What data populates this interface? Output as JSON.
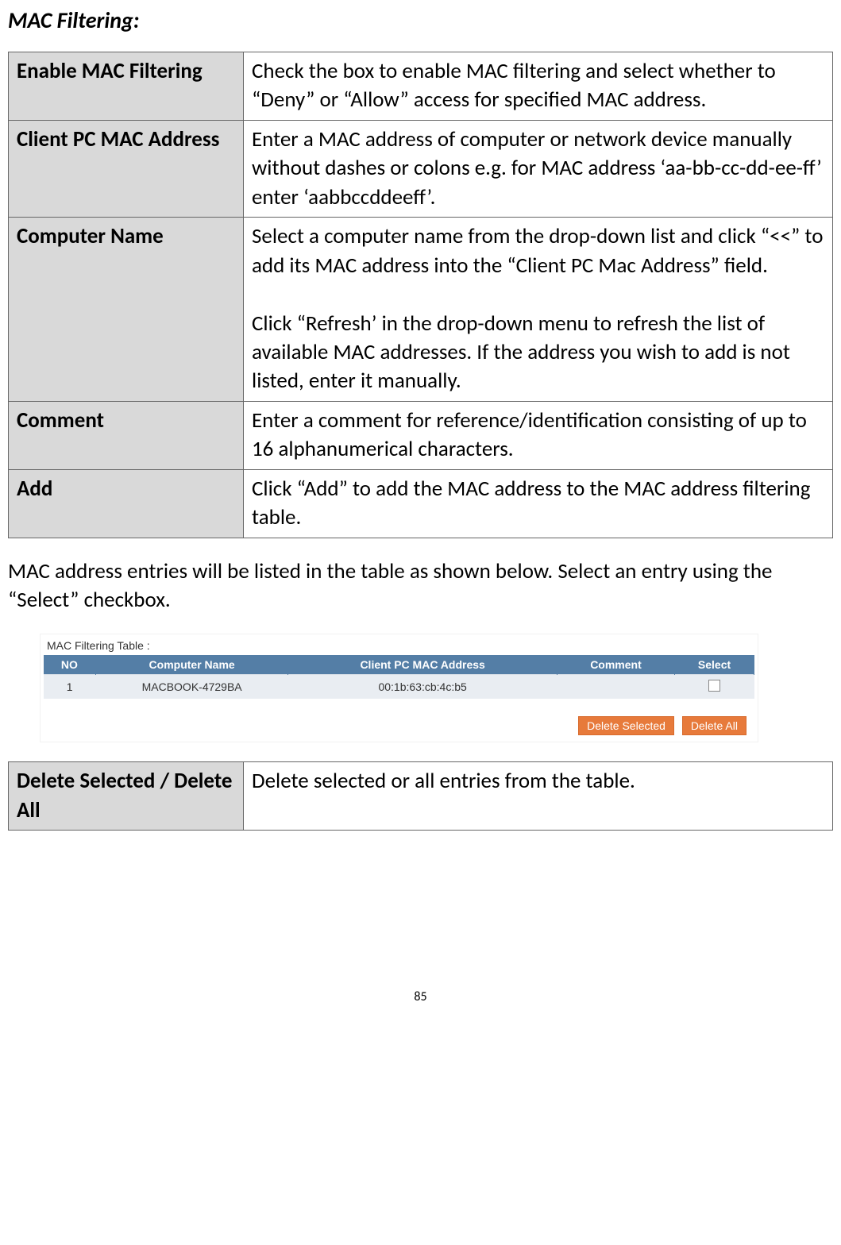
{
  "title": "MAC Filtering:",
  "rows1": [
    {
      "label": "Enable MAC Filtering",
      "desc": "Check the box to enable MAC filtering and select whether to “Deny” or “Allow” access for specified MAC address."
    },
    {
      "label": "Client PC MAC Address",
      "desc": "Enter a MAC address of computer or network device manually without dashes or colons e.g. for MAC address ‘aa-bb-cc-dd-ee-ff’ enter ‘aabbccddeeff’."
    },
    {
      "label": "Computer Name",
      "desc": "Select a computer name from the drop-down list and click “<<” to add its MAC address into the “Client PC Mac Address” field.\n\nClick “Refresh’ in the drop-down menu to refresh the list of available MAC addresses. If the address you wish to add is not listed, enter it manually."
    },
    {
      "label": "Comment",
      "desc": "Enter a comment for reference/identification consisting of up to 16 alphanumerical characters."
    },
    {
      "label": "Add",
      "desc": "Click “Add” to add the MAC address to the MAC address filtering table."
    }
  ],
  "midpara": "MAC address entries will be listed in the table as shown below. Select an entry using the “Select” checkbox.",
  "screenshot": {
    "caption": "MAC Filtering  Table :",
    "headers": {
      "no": "NO",
      "name": "Computer Name",
      "mac": "Client PC   MAC Address",
      "comment": "Comment",
      "select": "Select"
    },
    "row": {
      "no": "1",
      "name": "MACBOOK-4729BA",
      "mac": "00:1b:63:cb:4c:b5",
      "comment": ""
    },
    "buttons": {
      "delsel": "Delete Selected",
      "delall": "Delete All"
    }
  },
  "rows2": [
    {
      "label": "Delete Selected / Delete All",
      "desc": "Delete selected or all entries from the table."
    }
  ],
  "pagenum": "85"
}
